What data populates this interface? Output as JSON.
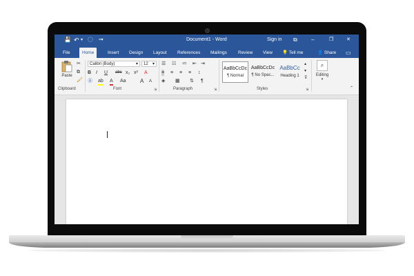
{
  "window": {
    "title": "Document1 - Word",
    "sign_in": "Sign in",
    "minimize": "–",
    "restore": "❐",
    "close": "✕",
    "ribbon_display": "⧉"
  },
  "qat": {
    "save": "💾",
    "undo": "↶",
    "undo_dropdown": "▾",
    "redo": "◯",
    "customize": "=▾"
  },
  "tabs": [
    "File",
    "Home",
    "Insert",
    "Design",
    "Layout",
    "References",
    "Mailings",
    "Review",
    "View"
  ],
  "tell_me": "Tell me",
  "share": "Share",
  "comments_icon": "▭",
  "clipboard": {
    "paste": "Paste",
    "label": "Clipboard"
  },
  "font": {
    "family": "Calibri (Body)",
    "size": "12",
    "label": "Font",
    "bold": "B",
    "italic": "I",
    "underline": "U",
    "strikethrough": "abc",
    "subscript": "x₂",
    "superscript": "x²",
    "grow": "A",
    "shrink": "A",
    "case": "Aa",
    "clear": "A"
  },
  "paragraph": {
    "label": "Paragraph",
    "pilcrow": "¶"
  },
  "styles": {
    "label": "Styles",
    "items": [
      {
        "preview": "AaBbCcDc",
        "name": "¶ Normal"
      },
      {
        "preview": "AaBbCcDc",
        "name": "¶ No Spac..."
      },
      {
        "preview": "AaBbCc",
        "name": "Heading 1"
      }
    ]
  },
  "editing": {
    "label": "Editing"
  },
  "colors": {
    "word_blue": "#2b579a",
    "highlight": "#ffff00",
    "font_red": "#d32f2f"
  }
}
